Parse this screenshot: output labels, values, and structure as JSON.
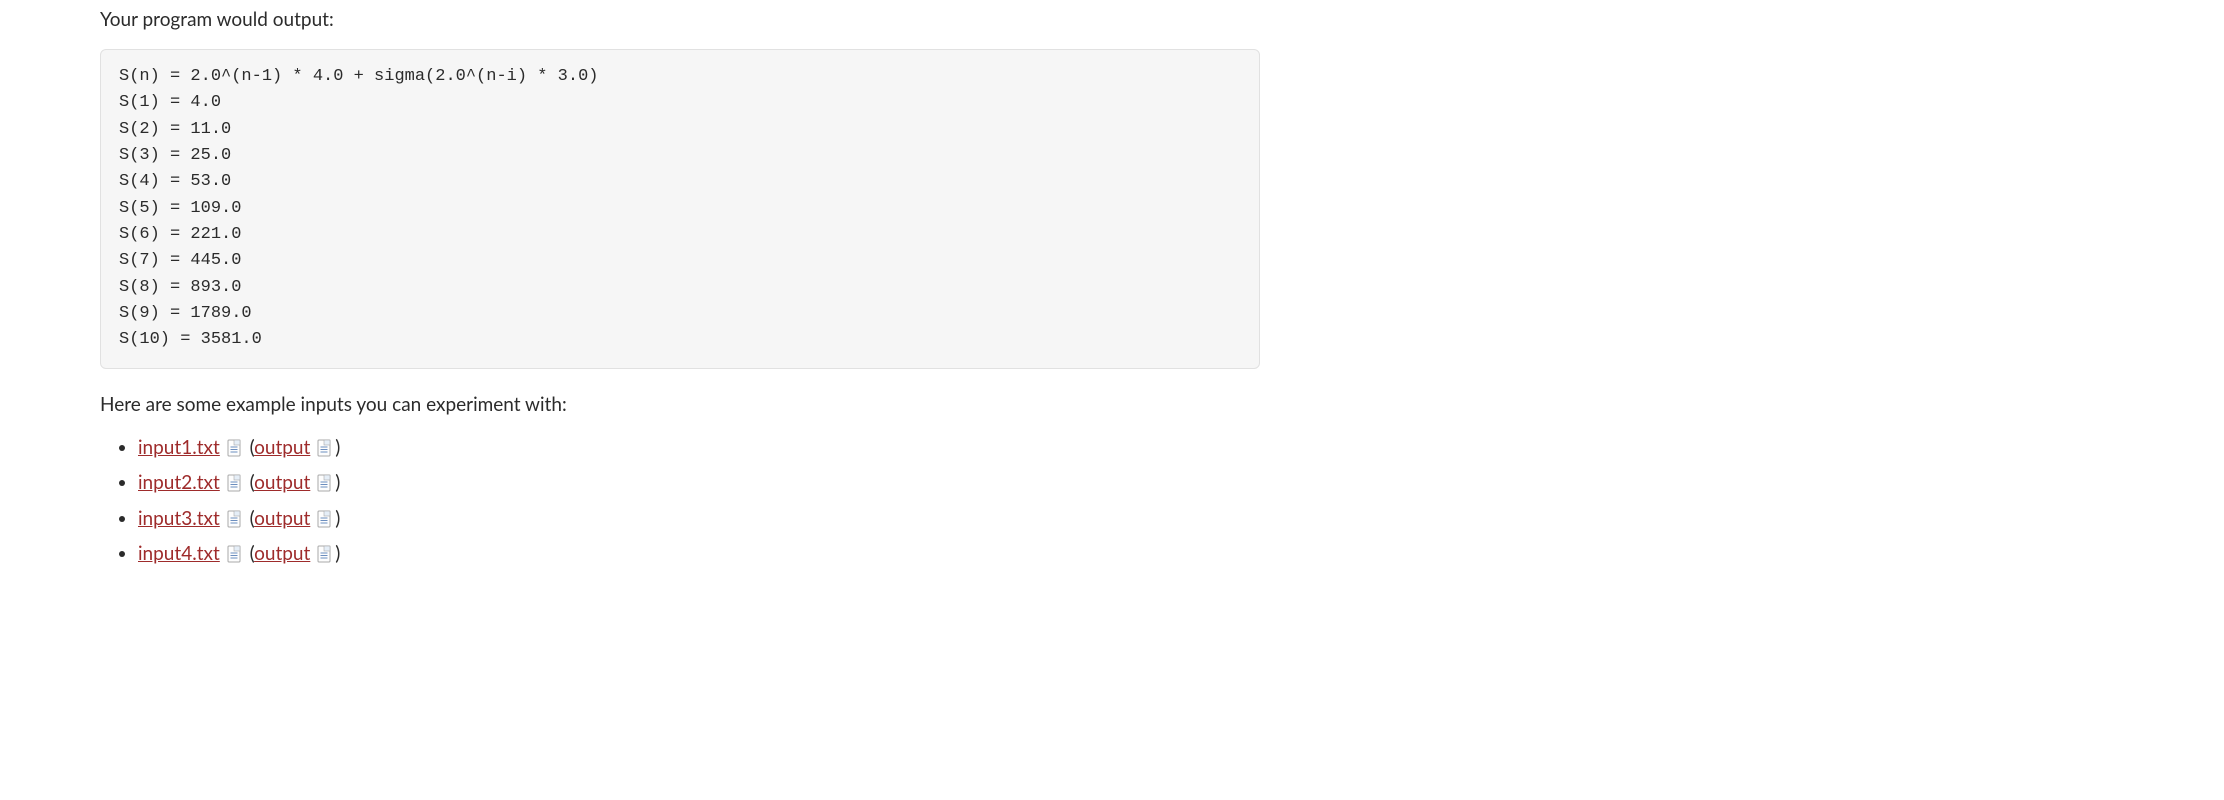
{
  "intro": "Your program would output:",
  "code_output": "S(n) = 2.0^(n-1) * 4.0 + sigma(2.0^(n-i) * 3.0)\nS(1) = 4.0\nS(2) = 11.0\nS(3) = 25.0\nS(4) = 53.0\nS(5) = 109.0\nS(6) = 221.0\nS(7) = 445.0\nS(8) = 893.0\nS(9) = 1789.0\nS(10) = 3581.0",
  "example_text": "Here are some example inputs you can experiment with:",
  "files": [
    {
      "input_label": "input1.txt",
      "output_label": "output"
    },
    {
      "input_label": "input2.txt",
      "output_label": "output"
    },
    {
      "input_label": "input3.txt",
      "output_label": "output"
    },
    {
      "input_label": "input4.txt",
      "output_label": "output"
    }
  ]
}
